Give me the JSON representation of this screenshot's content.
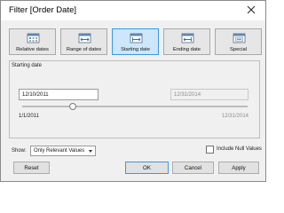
{
  "window": {
    "title": "Filter [Order Date]"
  },
  "tabs": [
    {
      "label": "Relative dates",
      "icon": "relative-dates-icon",
      "active": false
    },
    {
      "label": "Range of dates",
      "icon": "range-of-dates-icon",
      "active": false
    },
    {
      "label": "Starting date",
      "icon": "starting-date-icon",
      "active": true
    },
    {
      "label": "Ending date",
      "icon": "ending-date-icon",
      "active": false
    },
    {
      "label": "Special",
      "icon": "special-icon",
      "active": false
    }
  ],
  "panel": {
    "label": "Starting date",
    "start_value": "12/10/2011",
    "end_value": "12/31/2014",
    "range_min": "1/1/2011",
    "range_max": "12/31/2014"
  },
  "show": {
    "label": "Show:",
    "selected": "Only Relevant Values"
  },
  "include_null": {
    "label": "Include Null Values",
    "checked": false
  },
  "buttons": {
    "reset": "Reset",
    "ok": "OK",
    "cancel": "Cancel",
    "apply": "Apply"
  },
  "colors": {
    "accent": "#3c98e4",
    "active_tab_bg": "#cde6fa",
    "dialog_bg": "#f0f0f0"
  }
}
